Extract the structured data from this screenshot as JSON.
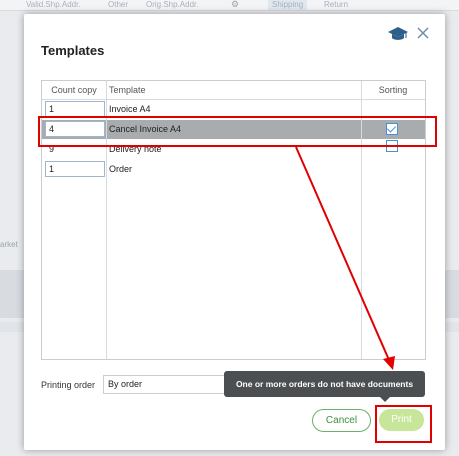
{
  "background": {
    "tabs": [
      "Valid.Shp.Addr.",
      "Other",
      "Orig.Shp.Addr.",
      "Shipping",
      "Return"
    ],
    "side_text": "arket"
  },
  "dialog": {
    "title": "Templates",
    "table": {
      "headers": [
        "Count copy",
        "Template",
        "Sorting"
      ],
      "rows": [
        {
          "count": "1",
          "template": "Invoice A4",
          "sorting": false,
          "selected": false
        },
        {
          "count": "4",
          "template": "Cancel Invoice A4",
          "sorting": true,
          "selected": true
        },
        {
          "count": "9",
          "template": "Delivery note",
          "sorting": false,
          "selected": false
        },
        {
          "count": "1",
          "template": "Order",
          "sorting": false,
          "selected": false
        }
      ]
    },
    "printing_order": {
      "label": "Printing order",
      "value": "By order"
    },
    "tooltip": "One or more orders do not have documents",
    "buttons": {
      "cancel": "Cancel",
      "print": "Print"
    }
  },
  "colors": {
    "annotation": "#e10000",
    "accent": "#4a90d9",
    "print_disabled": "#c7e69a",
    "cancel": "#3e8f3c"
  }
}
